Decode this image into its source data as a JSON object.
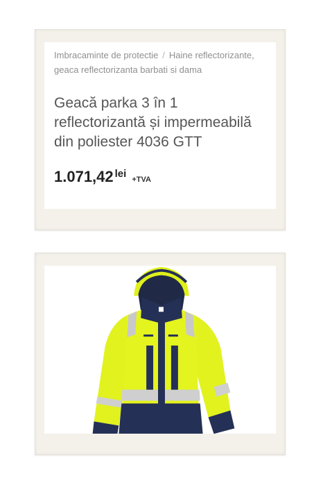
{
  "breadcrumb": {
    "parent": "Imbracaminte de protectie",
    "separator": "/",
    "current": "Haine reflectorizante, geaca reflectorizanta barbati si dama"
  },
  "product": {
    "title": "Geacă parka 3 în 1 reflectorizantă și impermeabilă din poliester 4036 GTT",
    "price": "1.071,42",
    "currency": "lei",
    "vat_note": "+TVA",
    "image_icon": "hi-vis-jacket-image"
  },
  "colors": {
    "hi_vis_yellow": "#e3f21f",
    "navy": "#232c4a",
    "reflective_silver": "#c9c9c9",
    "frame": "#f4f1ea"
  }
}
